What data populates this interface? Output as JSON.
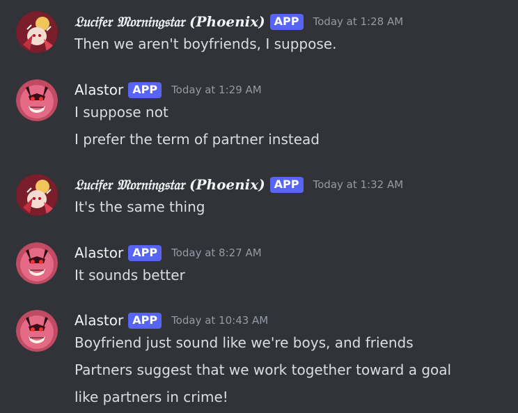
{
  "messages": [
    {
      "author": "𝔏𝔲𝔠𝔦𝔣𝔢𝔯 𝔐𝔬𝔯𝔫𝔦𝔫𝔤𝔰𝔱𝔞𝔯 (Phoenix)",
      "badge": "APP",
      "timestamp": "Today at 1:28 AM",
      "lines": [
        "Then we aren't boyfriends, I suppose."
      ]
    },
    {
      "author": "Alastor",
      "badge": "APP",
      "timestamp": "Today at 1:29 AM",
      "lines": [
        "I suppose not",
        "I prefer the term of partner instead"
      ]
    },
    {
      "author": "𝔏𝔲𝔠𝔦𝔣𝔢𝔯 𝔐𝔬𝔯𝔫𝔦𝔫𝔤𝔰𝔱𝔞𝔯 (Phoenix)",
      "badge": "APP",
      "timestamp": "Today at 1:32 AM",
      "lines": [
        "It's the same thing"
      ]
    },
    {
      "author": "Alastor",
      "badge": "APP",
      "timestamp": "Today at 8:27 AM",
      "lines": [
        "It sounds better"
      ]
    },
    {
      "author": "Alastor",
      "badge": "APP",
      "timestamp": "Today at 10:43 AM",
      "lines": [
        "Boyfriend just sound like we're boys, and friends",
        "Partners suggest that we work together toward a goal",
        "like partners in crime!"
      ]
    }
  ],
  "colors": {
    "background": "#313338",
    "badge": "#5865f2",
    "username": "#f2f3f5",
    "text": "#dbdee1",
    "timestamp": "#949ba4"
  }
}
